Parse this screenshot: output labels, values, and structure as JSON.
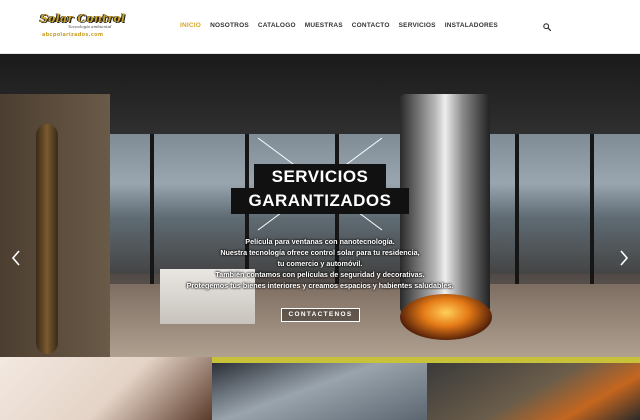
{
  "header": {
    "logo": {
      "name": "Solar Control",
      "tagline": "Tecnología ambiental",
      "url": "abcpolarizados.com"
    },
    "nav": [
      {
        "label": "INICIO",
        "active": true
      },
      {
        "label": "NOSOTROS",
        "active": false
      },
      {
        "label": "CATALOGO",
        "active": false
      },
      {
        "label": "MUESTRAS",
        "active": false
      },
      {
        "label": "CONTACTO",
        "active": false
      },
      {
        "label": "SERVICIOS",
        "active": false
      },
      {
        "label": "INSTALADORES",
        "active": false
      }
    ],
    "search_icon": "search-icon"
  },
  "hero": {
    "title_line1": "SERVICIOS",
    "title_line2": "GARANTIZADOS",
    "description": [
      "Película para ventanas con nanotecnología.",
      "Nuestra tecnología ofrece control solar para tu residencia,",
      "tu comercio y automóvil.",
      "También contamos con películas de seguridad y decorativas.",
      "Protegemos tus bienes interiores y creamos espacios y habientes saludables."
    ],
    "cta_label": "CONTACTENOS",
    "prev_icon": "chevron-left-icon",
    "next_icon": "chevron-right-icon"
  },
  "colors": {
    "accent": "#d4a62a",
    "strip_accent": "#c7c23a",
    "tag_bg": "#111111"
  }
}
